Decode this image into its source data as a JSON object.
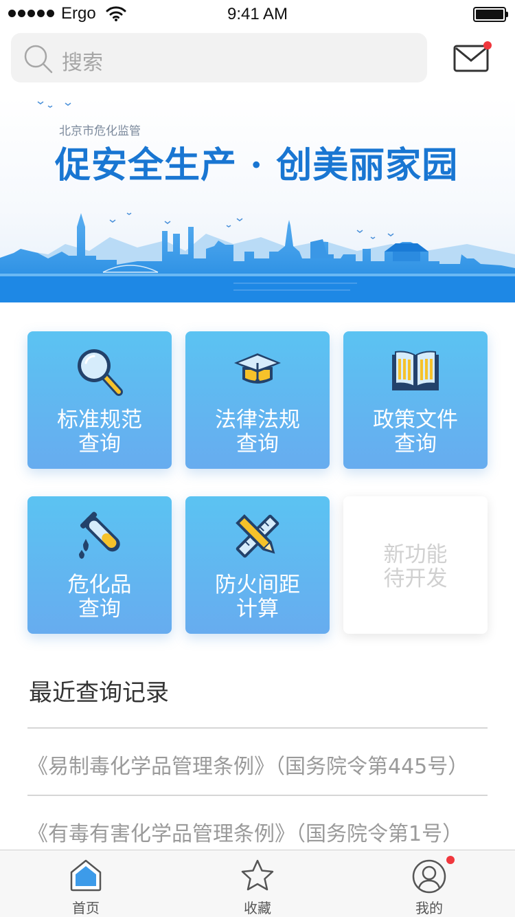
{
  "status_bar": {
    "carrier": "Ergo",
    "time": "9:41 AM"
  },
  "search": {
    "placeholder": "搜索"
  },
  "banner": {
    "subtitle": "北京市危化监管",
    "title": "促安全生产 · 创美丽家园"
  },
  "tiles": [
    {
      "line1": "标准规范",
      "line2": "查询",
      "icon": "magnifier-icon"
    },
    {
      "line1": "法律法规",
      "line2": "查询",
      "icon": "graduation-cap-icon"
    },
    {
      "line1": "政策文件",
      "line2": "查询",
      "icon": "open-book-icon"
    },
    {
      "line1": "危化品",
      "line2": "查询",
      "icon": "test-tube-icon"
    },
    {
      "line1": "防火间距",
      "line2": "计算",
      "icon": "pencil-ruler-icon"
    },
    {
      "line1": "新功能",
      "line2": "待开发"
    }
  ],
  "recent": {
    "title": "最近查询记录",
    "items": [
      "《易制毒化学品管理条例》（国务院令第445号）",
      "《有毒有害化学品管理条例》（国务院令第1号）"
    ]
  },
  "tabbar": [
    {
      "label": "首页",
      "icon": "home-icon"
    },
    {
      "label": "收藏",
      "icon": "star-icon"
    },
    {
      "label": "我的",
      "icon": "profile-icon"
    }
  ],
  "colors": {
    "accent": "#1976d2",
    "tile_top": "#5bc3f2",
    "tile_bottom": "#67acef",
    "badge": "#f0373d",
    "icon_yellow": "#f6c22a",
    "icon_navy": "#23426b"
  }
}
